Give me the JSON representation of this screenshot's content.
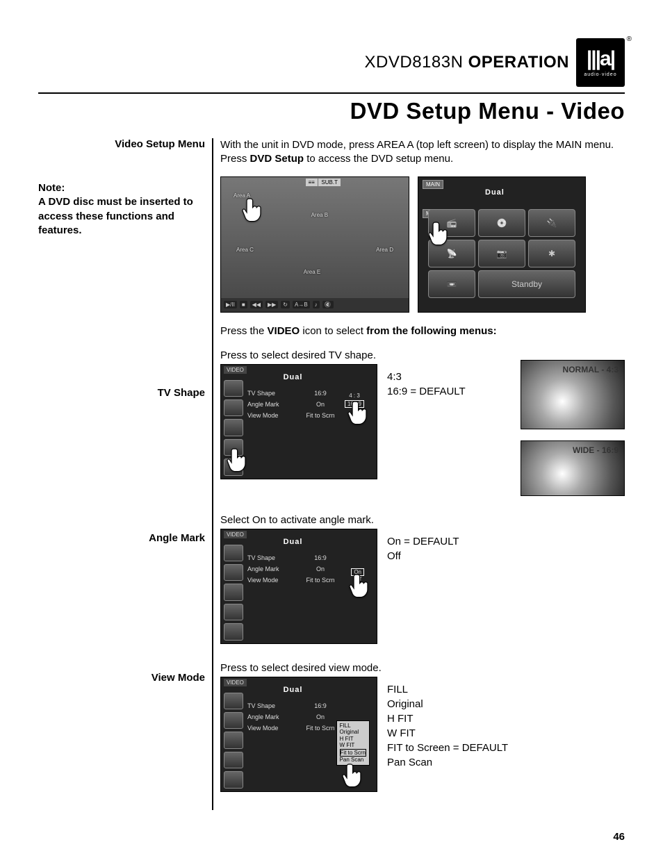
{
  "header": {
    "model": "XDVD8183N",
    "op": "OPERATION",
    "logo_main": "Dual",
    "logo_sub": "audio·video"
  },
  "main_title": "DVD Setup Menu - Video",
  "left": {
    "section1": "Video Setup Menu",
    "note_label": "Note:",
    "note_body": "A DVD disc must be inserted to access these functions and features.",
    "section2": "TV Shape",
    "section3": "Angle Mark",
    "section4": "View Mode"
  },
  "intro": {
    "line1a": "With the unit in DVD mode, press AREA A (top left screen) to display the MAIN menu. Press ",
    "line1b": "DVD Setup",
    "line1c": " to access the DVD setup menu."
  },
  "screens": {
    "s1": {
      "eq": "≡≡",
      "subt": "SUB.T",
      "areaA": "Area A",
      "areaB": "Area B",
      "areaC": "Area C",
      "areaD": "Area D",
      "areaE": "Area E",
      "bb1": "▶/II",
      "bb2": "■",
      "bb3": "◀◀",
      "bb4": "▶▶",
      "bb5": "↻",
      "bb6": "A→B",
      "bb7": "♪",
      "bb8": "🔇"
    },
    "s2": {
      "main1": "MAIN",
      "brand": "Dual",
      "main2": "MAIN",
      "standby": "Standby",
      "i1": "📻",
      "i2": "💿",
      "i3": "🔌",
      "i4": "📡",
      "i5": "📷",
      "i6": "✱",
      "i7": "📼"
    }
  },
  "below1": {
    "a": "Press the ",
    "b": "VIDEO",
    "c": " icon to select ",
    "d": "from the following menus:"
  },
  "tvshape": {
    "desc": "Press to select desired TV shape.",
    "v1": "4:3",
    "v2": "16:9 = DEFAULT",
    "preview1": "NORMAL - 4:3",
    "preview2": "WIDE - 16:9",
    "menu": {
      "title": "VIDEO",
      "brand": "Dual",
      "r1c1": "TV Shape",
      "r1c2": "16:9",
      "r2c1": "Angle Mark",
      "r2c2": "On",
      "r3c1": "View Mode",
      "r3c2": "Fit to Scrn",
      "pop1": "4 : 3",
      "pop2": "16 : 9"
    }
  },
  "anglemark": {
    "desc": "Select On to activate angle mark.",
    "v1": "On = DEFAULT",
    "v2": "Off",
    "menu": {
      "title": "VIDEO",
      "brand": "Dual",
      "r1c1": "TV Shape",
      "r1c2": "16:9",
      "r2c1": "Angle Mark",
      "r2c2": "On",
      "r3c1": "View Mode",
      "r3c2": "Fit to Scrn",
      "pop1": "On",
      "pop2": "Off"
    }
  },
  "viewmode": {
    "desc": "Press to select desired view mode.",
    "v1": "FILL",
    "v2": "Original",
    "v3": "H FIT",
    "v4": "W FIT",
    "v5": "FIT to Screen = DEFAULT",
    "v6": "Pan Scan",
    "menu": {
      "title": "VIDEO",
      "brand": "Dual",
      "r1c1": "TV Shape",
      "r1c2": "16:9",
      "r2c1": "Angle Mark",
      "r2c2": "On",
      "r3c1": "View Mode",
      "r3c2": "Fit to Scrn",
      "p1": "FILL",
      "p2": "Original",
      "p3": "H  FIT",
      "p4": "W  FIT",
      "p5": "Fit  to  Scrn",
      "p6": "Pan  Scan"
    }
  },
  "page": "46"
}
